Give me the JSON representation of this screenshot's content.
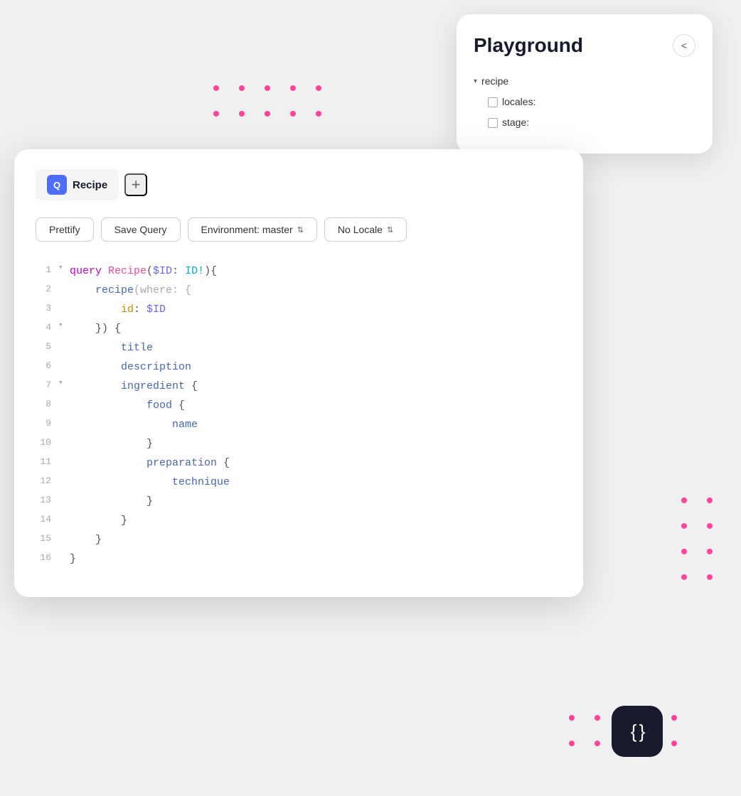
{
  "playground": {
    "title": "Playground",
    "close_label": "<",
    "tree": {
      "items": [
        {
          "type": "parent",
          "label": "recipe",
          "indent": 0
        },
        {
          "type": "checkbox",
          "label": "locales:",
          "indent": 1
        },
        {
          "type": "checkbox",
          "label": "stage:",
          "indent": 1
        }
      ]
    }
  },
  "query_card": {
    "tab": {
      "icon": "Q",
      "label": "Recipe",
      "add_label": "+"
    },
    "toolbar": {
      "prettify_label": "Prettify",
      "save_query_label": "Save Query",
      "environment_label": "Environment: master",
      "locale_label": "No Locale"
    },
    "code_lines": [
      {
        "num": "1",
        "toggle": "▾",
        "content": "query Recipe($ID: ID!){",
        "parts": [
          {
            "text": "query ",
            "class": "kw-query"
          },
          {
            "text": "Recipe",
            "class": "kw-name"
          },
          {
            "text": "(",
            "class": "kw-brace"
          },
          {
            "text": "$ID",
            "class": "kw-value"
          },
          {
            "text": ": ",
            "class": "kw-punct"
          },
          {
            "text": "ID!",
            "class": "kw-type"
          },
          {
            "text": "){",
            "class": "kw-brace"
          }
        ]
      },
      {
        "num": "2",
        "toggle": "",
        "content": "    recipe(where: {",
        "parts": [
          {
            "text": "    recipe",
            "class": "kw-field"
          },
          {
            "text": "(where: {",
            "class": "kw-where"
          }
        ]
      },
      {
        "num": "3",
        "toggle": "",
        "content": "        id: $ID",
        "parts": [
          {
            "text": "        id",
            "class": "kw-id"
          },
          {
            "text": ": ",
            "class": "kw-punct"
          },
          {
            "text": "$ID",
            "class": "kw-value"
          }
        ]
      },
      {
        "num": "4",
        "toggle": "▾",
        "content": "    }) {",
        "parts": [
          {
            "text": "    }) {",
            "class": "kw-brace"
          }
        ]
      },
      {
        "num": "5",
        "toggle": "",
        "content": "        title",
        "parts": [
          {
            "text": "        title",
            "class": "kw-field"
          }
        ]
      },
      {
        "num": "6",
        "toggle": "",
        "content": "        description",
        "parts": [
          {
            "text": "        description",
            "class": "kw-field"
          }
        ]
      },
      {
        "num": "7",
        "toggle": "▾",
        "content": "        ingredient {",
        "parts": [
          {
            "text": "        ingredient ",
            "class": "kw-field"
          },
          {
            "text": "{",
            "class": "kw-brace"
          }
        ]
      },
      {
        "num": "8",
        "toggle": "",
        "content": "            food {",
        "parts": [
          {
            "text": "            food ",
            "class": "kw-field"
          },
          {
            "text": "{",
            "class": "kw-brace"
          }
        ]
      },
      {
        "num": "9",
        "toggle": "",
        "content": "                name",
        "parts": [
          {
            "text": "                name",
            "class": "kw-field"
          }
        ]
      },
      {
        "num": "10",
        "toggle": "",
        "content": "            }",
        "parts": [
          {
            "text": "            }",
            "class": "kw-brace"
          }
        ]
      },
      {
        "num": "11",
        "toggle": "",
        "content": "            preparation {",
        "parts": [
          {
            "text": "            preparation ",
            "class": "kw-field"
          },
          {
            "text": "{",
            "class": "kw-brace"
          }
        ]
      },
      {
        "num": "12",
        "toggle": "",
        "content": "                technique",
        "parts": [
          {
            "text": "                technique",
            "class": "kw-field"
          }
        ]
      },
      {
        "num": "13",
        "toggle": "",
        "content": "            }",
        "parts": [
          {
            "text": "            }",
            "class": "kw-brace"
          }
        ]
      },
      {
        "num": "14",
        "toggle": "",
        "content": "        }",
        "parts": [
          {
            "text": "        }",
            "class": "kw-brace"
          }
        ]
      },
      {
        "num": "15",
        "toggle": "",
        "content": "    }",
        "parts": [
          {
            "text": "    }",
            "class": "kw-brace"
          }
        ]
      },
      {
        "num": "16",
        "toggle": "",
        "content": "}",
        "parts": [
          {
            "text": "}",
            "class": "kw-brace"
          }
        ]
      }
    ]
  },
  "brand_icon": {
    "symbol": "{ }"
  },
  "colors": {
    "pink": "#FF4499",
    "primary_blue": "#4F6EF7",
    "dark": "#1a1a2e"
  }
}
